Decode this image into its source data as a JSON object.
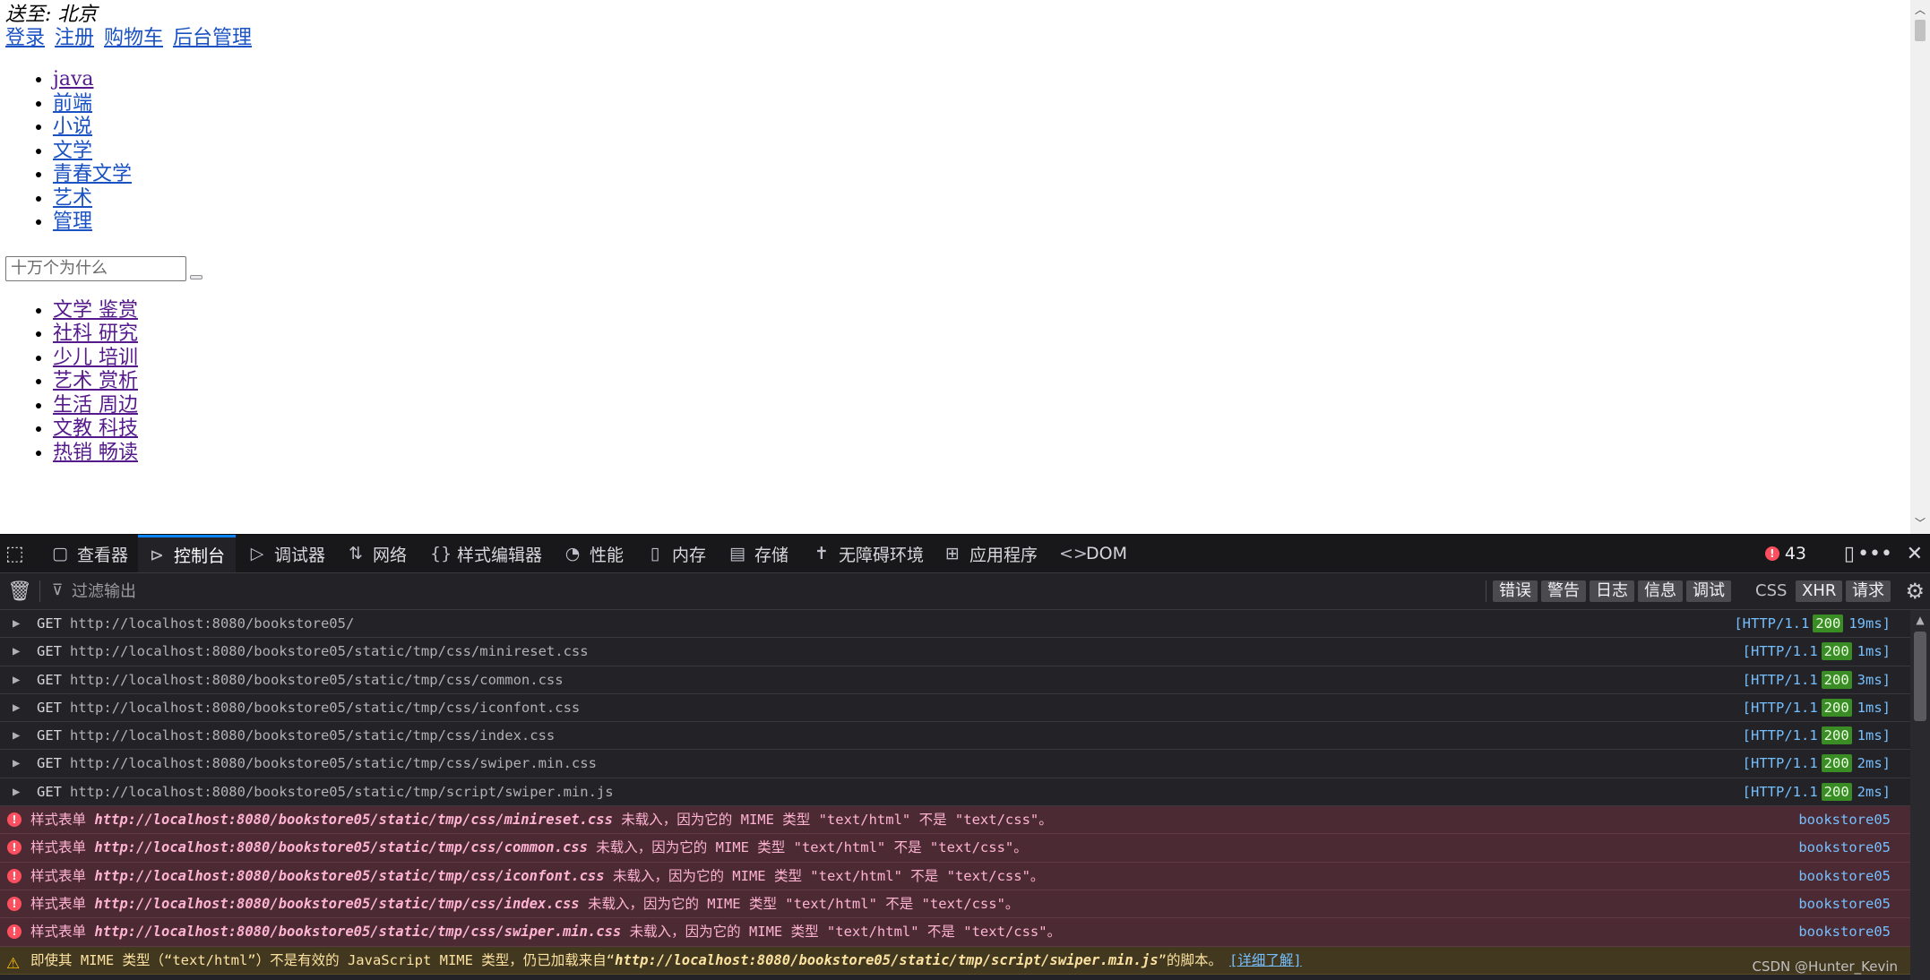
{
  "page": {
    "delivery_label": "送至: 北京",
    "top_links": [
      "登录",
      "注册",
      "购物车",
      "后台管理"
    ],
    "categories": [
      "java",
      "前端",
      "小说",
      "文学",
      "青春文学",
      "艺术",
      "管理"
    ],
    "search": {
      "placeholder": "十万个为什么"
    },
    "sub_categories": [
      "文学 鉴赏",
      "社科 研究",
      "少儿 培训",
      "艺术 赏析",
      "生活 周边",
      "文教 科技",
      "热销 畅读"
    ]
  },
  "devtools": {
    "tabs": [
      {
        "icon": "▢",
        "label": "查看器"
      },
      {
        "icon": "▶",
        "label": "控制台"
      },
      {
        "icon": "▷",
        "label": "调试器"
      },
      {
        "icon": "⇅",
        "label": "网络"
      },
      {
        "icon": "{}",
        "label": "样式编辑器"
      },
      {
        "icon": "◔",
        "label": "性能"
      },
      {
        "icon": "▯",
        "label": "内存"
      },
      {
        "icon": "▤",
        "label": "存储"
      },
      {
        "icon": "✝",
        "label": "无障碍环境"
      },
      {
        "icon": "⊞",
        "label": "应用程序"
      },
      {
        "icon": "<>",
        "label": "DOM"
      }
    ],
    "active_tab": "控制台",
    "error_count": "43",
    "filter_placeholder": "过滤输出",
    "level_filters": [
      "错误",
      "警告",
      "日志",
      "信息",
      "调试"
    ],
    "type_filters": [
      "CSS",
      "XHR",
      "请求"
    ],
    "network_rows": [
      {
        "method": "GET",
        "url": "http://localhost:8080/bookstore05/",
        "protocol": "[HTTP/1.1",
        "status": "200",
        "time": "19ms]"
      },
      {
        "method": "GET",
        "url": "http://localhost:8080/bookstore05/static/tmp/css/minireset.css",
        "protocol": "[HTTP/1.1",
        "status": "200",
        "time": "1ms]"
      },
      {
        "method": "GET",
        "url": "http://localhost:8080/bookstore05/static/tmp/css/common.css",
        "protocol": "[HTTP/1.1",
        "status": "200",
        "time": "3ms]"
      },
      {
        "method": "GET",
        "url": "http://localhost:8080/bookstore05/static/tmp/css/iconfont.css",
        "protocol": "[HTTP/1.1",
        "status": "200",
        "time": "1ms]"
      },
      {
        "method": "GET",
        "url": "http://localhost:8080/bookstore05/static/tmp/css/index.css",
        "protocol": "[HTTP/1.1",
        "status": "200",
        "time": "1ms]"
      },
      {
        "method": "GET",
        "url": "http://localhost:8080/bookstore05/static/tmp/css/swiper.min.css",
        "protocol": "[HTTP/1.1",
        "status": "200",
        "time": "2ms]"
      },
      {
        "method": "GET",
        "url": "http://localhost:8080/bookstore05/static/tmp/script/swiper.min.js",
        "protocol": "[HTTP/1.1",
        "status": "200",
        "time": "2ms]"
      }
    ],
    "error_rows": [
      {
        "prefix": "样式表单",
        "url": "http://localhost:8080/bookstore05/static/tmp/css/minireset.css",
        "suffix": "未载入，因为它的 MIME 类型 \"text/html\" 不是 \"text/css\"。",
        "source": "bookstore05"
      },
      {
        "prefix": "样式表单",
        "url": "http://localhost:8080/bookstore05/static/tmp/css/common.css",
        "suffix": "未载入，因为它的 MIME 类型 \"text/html\" 不是 \"text/css\"。",
        "source": "bookstore05"
      },
      {
        "prefix": "样式表单",
        "url": "http://localhost:8080/bookstore05/static/tmp/css/iconfont.css",
        "suffix": "未载入，因为它的 MIME 类型 \"text/html\" 不是 \"text/css\"。",
        "source": "bookstore05"
      },
      {
        "prefix": "样式表单",
        "url": "http://localhost:8080/bookstore05/static/tmp/css/index.css",
        "suffix": "未载入，因为它的 MIME 类型 \"text/html\" 不是 \"text/css\"。",
        "source": "bookstore05"
      },
      {
        "prefix": "样式表单",
        "url": "http://localhost:8080/bookstore05/static/tmp/css/swiper.min.css",
        "suffix": "未载入，因为它的 MIME 类型 \"text/html\" 不是 \"text/css\"。",
        "source": "bookstore05"
      }
    ],
    "warning_row": {
      "prefix": "即使其 MIME 类型（“text/html”）不是有效的 JavaScript MIME 类型，仍已加载来自“",
      "url": "http://localhost:8080/bookstore05/static/tmp/script/swiper.min.js",
      "suffix": "”的脚本。",
      "link": "[详细了解]"
    },
    "watermark": "CSDN @Hunter_Kevin"
  },
  "colors": {
    "link": "#1a52c4",
    "visited_link": "#551a8b",
    "active_tab_accent": "#0a84ff",
    "error_badge": "#ff4f5e",
    "status_ok": "#3a8c24"
  }
}
